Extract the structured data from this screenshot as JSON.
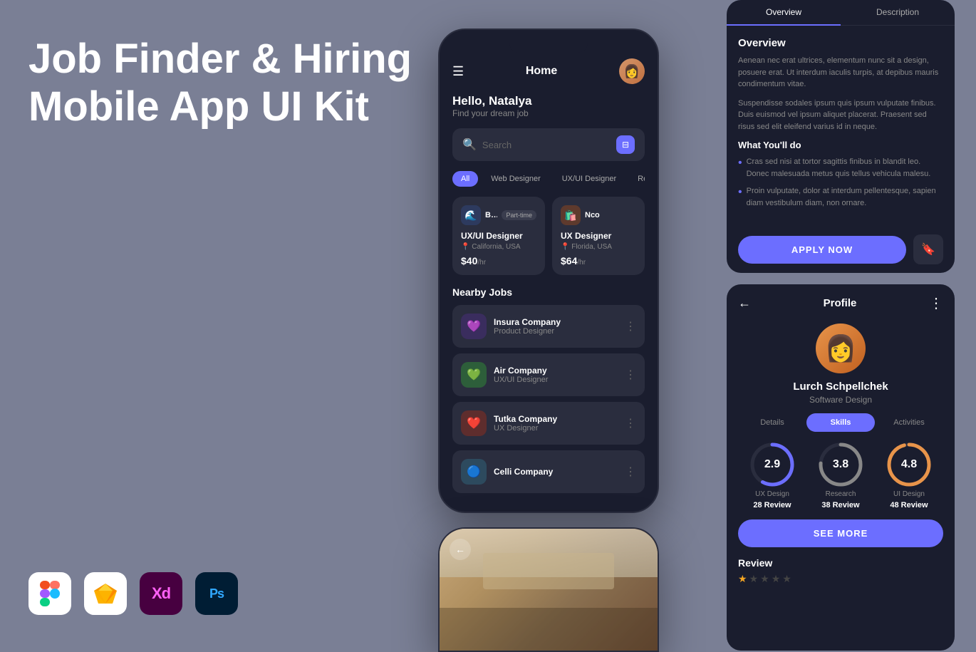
{
  "page": {
    "background": "#7a7f95"
  },
  "hero": {
    "title_line1": "Job Finder & Hiring",
    "title_line2": "Mobile App UI Kit"
  },
  "tools": [
    {
      "name": "Figma",
      "icon": "figma-icon",
      "bg": "#ffffff"
    },
    {
      "name": "Sketch",
      "icon": "sketch-icon",
      "bg": "#ffffff"
    },
    {
      "name": "XD",
      "icon": "xd-icon",
      "bg": "#470040"
    },
    {
      "name": "Photoshop",
      "icon": "ps-icon",
      "bg": "#001d34"
    }
  ],
  "home_screen": {
    "title": "Home",
    "greeting": "Hello, Natalya",
    "subtitle": "Find your dream job",
    "search_placeholder": "Search",
    "filter_tabs": [
      "All",
      "Web Designer",
      "UX/UI Designer",
      "Recommended"
    ],
    "active_tab": "All",
    "job_cards": [
      {
        "company": "Bay Comp.",
        "badge": "Part-time",
        "role": "UX/UI Designer",
        "location": "California, USA",
        "salary": "$40",
        "unit": "/hr"
      },
      {
        "company": "Nco",
        "badge": "",
        "role": "UX Designer",
        "location": "Florida, USA",
        "salary": "$64",
        "unit": "/hr"
      }
    ],
    "nearby_title": "Nearby Jobs",
    "nearby_jobs": [
      {
        "company": "Insura Company",
        "role": "Product Designer"
      },
      {
        "company": "Air Company",
        "role": "UX/UI Designer"
      },
      {
        "company": "Tutka Company",
        "role": "UX Designer"
      },
      {
        "company": "Celli Company",
        "role": ""
      }
    ]
  },
  "detail_card": {
    "tabs": [
      "Overview",
      "Description"
    ],
    "active_tab": "Overview",
    "section_title": "Overview",
    "para1": "Aenean nec erat ultrices, elementum nunc sit a design, posuere erat. Ut interdum iaculis turpis, at depibus mauris condimentum vitae.",
    "para2": "Suspendisse sodales ipsum quis ipsum vulputate finibus. Duis euismod vel ipsum aliquet placerat. Praesent sed risus sed elit eleifend varius id in neque.",
    "what_title": "What You'll do",
    "bullets": [
      "Cras sed nisi at tortor sagittis finibus in blandit leo. Donec malesuada metus quis tellus vehicula malesu.",
      "Proin vulputate, dolor at interdum pellentesque, sapien diam vestibulum diam, non ornare."
    ],
    "apply_label": "APPLY NOW",
    "bookmark_icon": "🔖"
  },
  "profile_card": {
    "title": "Profile",
    "name": "Lurch Schpellchek",
    "role": "Software Design",
    "tabs": [
      "Details",
      "Skills",
      "Activities"
    ],
    "active_tab": "Skills",
    "skills": [
      {
        "label": "UX Design",
        "value": 2.9,
        "review": "28 Review",
        "color": "#6C6EFF",
        "pct": 58
      },
      {
        "label": "Research",
        "value": 3.8,
        "review": "38 Review",
        "color": "#888888",
        "pct": 76
      },
      {
        "label": "UI Design",
        "value": 4.8,
        "review": "48 Review",
        "color": "#e8944a",
        "pct": 96
      }
    ],
    "see_more_label": "SEE MORE",
    "review_title": "Review",
    "stars": 1
  }
}
